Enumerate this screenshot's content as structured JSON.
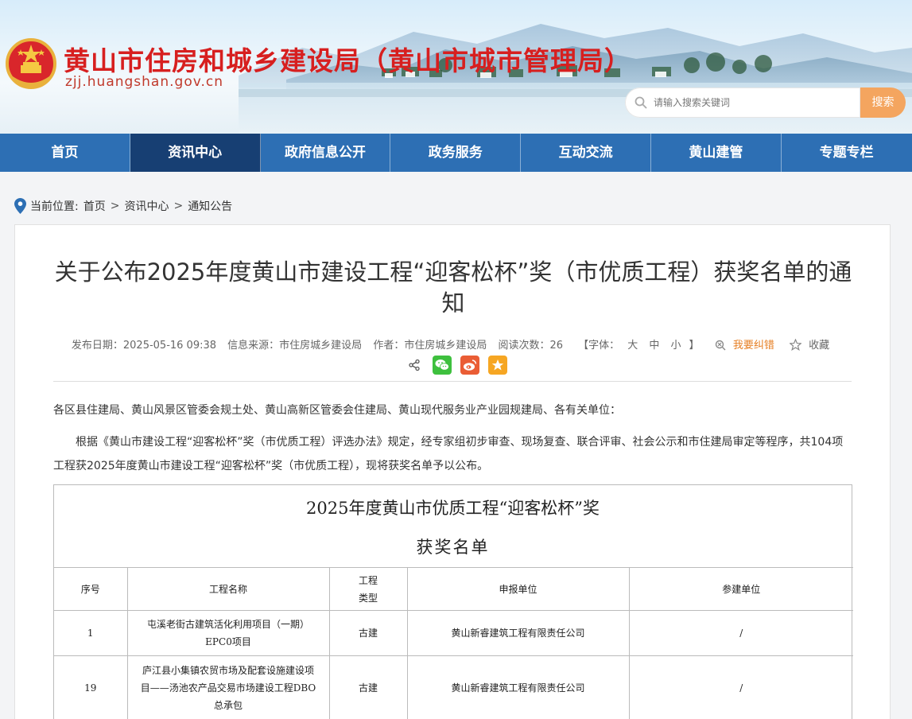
{
  "header": {
    "site_title": "黄山市住房和城乡建设局（黄山市城市管理局）",
    "site_domain": "zjj.huangshan.gov.cn",
    "search_placeholder": "请输入搜索关键词",
    "search_button": "搜索"
  },
  "nav": {
    "items": [
      {
        "label": "首页"
      },
      {
        "label": "资讯中心"
      },
      {
        "label": "政府信息公开"
      },
      {
        "label": "政务服务"
      },
      {
        "label": "互动交流"
      },
      {
        "label": "黄山建管"
      },
      {
        "label": "专题专栏"
      }
    ]
  },
  "breadcrumb": {
    "prefix": "当前位置:",
    "items": [
      "首页",
      "资讯中心",
      "通知公告"
    ],
    "sep": ">"
  },
  "article": {
    "title": "关于公布2025年度黄山市建设工程“迎客松杯”奖（市优质工程）获奖名单的通知",
    "meta": {
      "date": "发布日期：2025-05-16 09:38",
      "source": "信息来源：市住房城乡建设局",
      "author": "作者：市住房城乡建设局",
      "views": "阅读次数：26",
      "font_prefix": "【字体：",
      "font_large": "大",
      "font_medium": "中",
      "font_small": "小",
      "font_suffix": "】",
      "correct": "我要纠错",
      "favorite": "收藏"
    },
    "greeting": "各区县住建局、黄山风景区管委会规土处、黄山高新区管委会住建局、黄山现代服务业产业园规建局、各有关单位：",
    "paragraph": "根据《黄山市建设工程“迎客松杯”奖（市优质工程）评选办法》规定，经专家组初步审查、现场复查、联合评审、社会公示和市住建局审定等程序，共104项工程获2025年度黄山市建设工程“迎客松杯”奖（市优质工程），现将获奖名单予以公布。"
  },
  "table": {
    "title_line1": "2025年度黄山市优质工程“迎客松杯”奖",
    "title_line2": "获奖名单",
    "headers": {
      "no": "序号",
      "name": "工程名称",
      "type_line1": "工程",
      "type_line2": "类型",
      "applicant": "申报单位",
      "participant": "参建单位"
    },
    "rows": [
      {
        "no": "1",
        "name_lines": [
          "屯溪老街古建筑活化利用项目（一期）",
          "EPC0项目"
        ],
        "type": "古建",
        "applicant": "黄山新睿建筑工程有限责任公司",
        "participant": "/"
      },
      {
        "no": "19",
        "name_lines": [
          "庐江县小集镇农贸市场及配套设施建设项",
          "目——汤池农产品交易市场建设工程DBO",
          "总承包"
        ],
        "type": "古建",
        "applicant": "黄山新睿建筑工程有限责任公司",
        "participant": "/"
      }
    ]
  },
  "colors": {
    "nav_bg": "#2d6fb4",
    "nav_active": "#173f73",
    "title_red": "#d71f1f",
    "search_button": "#f4a55f",
    "correct_link": "#e67e22"
  },
  "icons": [
    "national-emblem-icon",
    "search-icon",
    "location-pin-icon",
    "correct-icon",
    "star-outline-icon",
    "share-icon",
    "wechat-icon",
    "weibo-icon",
    "qzone-icon"
  ]
}
